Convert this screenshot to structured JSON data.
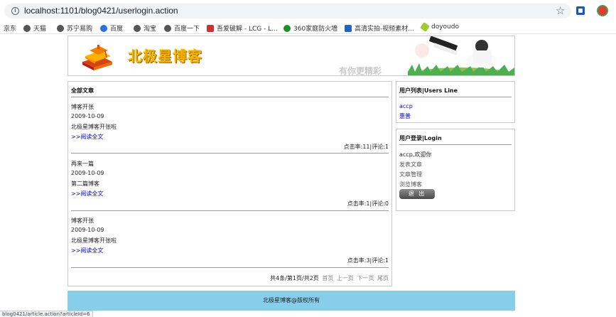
{
  "browser": {
    "url": "localhost:1101/blog0421/userlogin.action",
    "bookmarks": [
      "京东",
      "天猫",
      "苏宁易购",
      "百度",
      "淘宝",
      "百度一下",
      "吾爱破解 - LCG - L...",
      "360家庭防火墙",
      "高清实拍-视频素材...",
      "doyoudo"
    ],
    "status_url": "blog0421/article.action?articleId=6"
  },
  "banner": {
    "logo_text": "北极星博客",
    "slogan": "有你更精彩"
  },
  "main": {
    "title": "全部文章",
    "read_more": ">>阅读全文",
    "articles": [
      {
        "title": "博客开张",
        "date": "2009-10-09",
        "summary": "北极星博客开张啦",
        "stats": "点击率:11|评论:1"
      },
      {
        "title": "再来一篇",
        "date": "2009-10-09",
        "summary": "第二篇博客",
        "stats": "点击率:1|评论:0"
      },
      {
        "title": "博客开张",
        "date": "2009-10-09",
        "summary": "北极星博客开张啦",
        "stats": "点击率:3|评论:1"
      }
    ],
    "pager": {
      "summary": "共4条/第1页/共2页",
      "first": "首页",
      "prev": "上一页",
      "next": "下一页",
      "last": "尾页"
    }
  },
  "users_box": {
    "title": "用户列表|Users Line",
    "users": [
      "accp",
      "惠普"
    ]
  },
  "login_box": {
    "title": "用户登录|Login",
    "welcome": "accp,欢迎你",
    "menu": [
      "发表文章",
      "文章管理",
      "浏览博客"
    ],
    "logout": "退 出"
  },
  "footer": {
    "text": "北极星博客@版权所有"
  },
  "colors": {
    "footer_bg": "#87ceeb",
    "link": "#0000cc",
    "logo": "#f2b400"
  }
}
